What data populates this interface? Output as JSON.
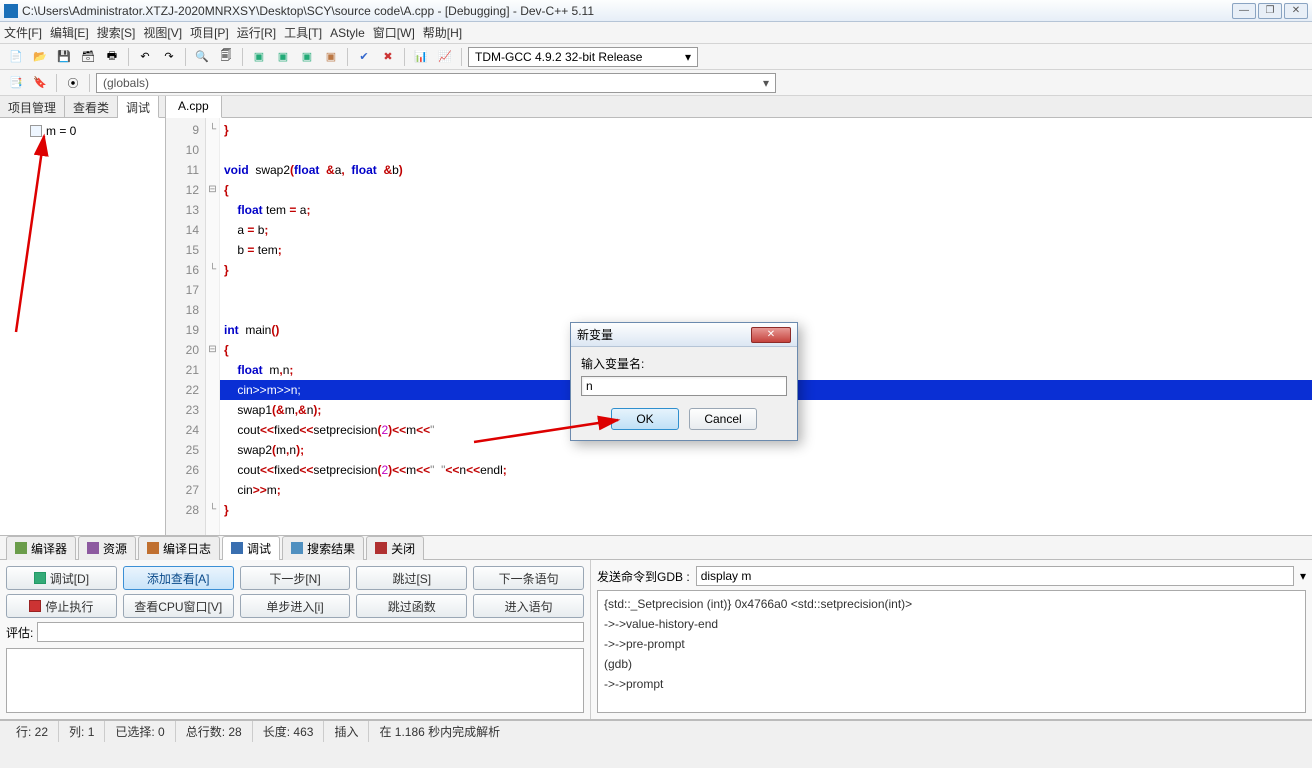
{
  "title": "C:\\Users\\Administrator.XTZJ-2020MNRXSY\\Desktop\\SCY\\source code\\A.cpp - [Debugging] - Dev-C++ 5.11",
  "menu": [
    "文件[F]",
    "编辑[E]",
    "搜索[S]",
    "视图[V]",
    "项目[P]",
    "运行[R]",
    "工具[T]",
    "AStyle",
    "窗口[W]",
    "帮助[H]"
  ],
  "compiler_selector": "TDM-GCC 4.9.2 32-bit Release",
  "globals_dropdown": "(globals)",
  "side_tabs": [
    "项目管理",
    "查看类",
    "调试"
  ],
  "side_active": 2,
  "watch_item": "m = 0",
  "editor_tab": "A.cpp",
  "code_lines": [
    {
      "n": 9,
      "fold": "└",
      "tokens": [
        {
          "c": "br",
          "t": "}"
        }
      ]
    },
    {
      "n": 10,
      "tokens": []
    },
    {
      "n": 11,
      "tokens": [
        {
          "c": "kw",
          "t": "void"
        },
        {
          "t": "  "
        },
        {
          "c": "fn",
          "t": "swap2"
        },
        {
          "c": "br",
          "t": "("
        },
        {
          "c": "typ",
          "t": "float"
        },
        {
          "t": "  "
        },
        {
          "c": "op",
          "t": "&"
        },
        {
          "c": "id",
          "t": "a"
        },
        {
          "c": "op",
          "t": ","
        },
        {
          "t": "  "
        },
        {
          "c": "typ",
          "t": "float"
        },
        {
          "t": "  "
        },
        {
          "c": "op",
          "t": "&"
        },
        {
          "c": "id",
          "t": "b"
        },
        {
          "c": "br",
          "t": ")"
        }
      ]
    },
    {
      "n": 12,
      "fold": "⊟",
      "tokens": [
        {
          "c": "br",
          "t": "{"
        }
      ]
    },
    {
      "n": 13,
      "tokens": [
        {
          "t": "    "
        },
        {
          "c": "typ",
          "t": "float"
        },
        {
          "t": " "
        },
        {
          "c": "id",
          "t": "tem"
        },
        {
          "t": " "
        },
        {
          "c": "op",
          "t": "="
        },
        {
          "t": " "
        },
        {
          "c": "id",
          "t": "a"
        },
        {
          "c": "op",
          "t": ";"
        }
      ]
    },
    {
      "n": 14,
      "tokens": [
        {
          "t": "    "
        },
        {
          "c": "id",
          "t": "a"
        },
        {
          "t": " "
        },
        {
          "c": "op",
          "t": "="
        },
        {
          "t": " "
        },
        {
          "c": "id",
          "t": "b"
        },
        {
          "c": "op",
          "t": ";"
        }
      ]
    },
    {
      "n": 15,
      "tokens": [
        {
          "t": "    "
        },
        {
          "c": "id",
          "t": "b"
        },
        {
          "t": " "
        },
        {
          "c": "op",
          "t": "="
        },
        {
          "t": " "
        },
        {
          "c": "id",
          "t": "tem"
        },
        {
          "c": "op",
          "t": ";"
        }
      ]
    },
    {
      "n": 16,
      "fold": "└",
      "tokens": [
        {
          "c": "br",
          "t": "}"
        }
      ]
    },
    {
      "n": 17,
      "tokens": []
    },
    {
      "n": 18,
      "tokens": []
    },
    {
      "n": 19,
      "tokens": [
        {
          "c": "kw",
          "t": "int"
        },
        {
          "t": "  "
        },
        {
          "c": "fn",
          "t": "main"
        },
        {
          "c": "br",
          "t": "()"
        }
      ]
    },
    {
      "n": 20,
      "fold": "⊟",
      "tokens": [
        {
          "c": "br",
          "t": "{"
        }
      ]
    },
    {
      "n": 21,
      "tokens": [
        {
          "t": "    "
        },
        {
          "c": "typ",
          "t": "float"
        },
        {
          "t": "  "
        },
        {
          "c": "id",
          "t": "m"
        },
        {
          "c": "op",
          "t": ","
        },
        {
          "c": "id",
          "t": "n"
        },
        {
          "c": "op",
          "t": ";"
        }
      ]
    },
    {
      "n": 22,
      "hl": true,
      "raw": "    cin>>m>>n;"
    },
    {
      "n": 23,
      "tokens": [
        {
          "t": "    "
        },
        {
          "c": "fn",
          "t": "swap1"
        },
        {
          "c": "br",
          "t": "("
        },
        {
          "c": "op",
          "t": "&"
        },
        {
          "c": "id",
          "t": "m"
        },
        {
          "c": "op",
          "t": ","
        },
        {
          "c": "op",
          "t": "&"
        },
        {
          "c": "id",
          "t": "n"
        },
        {
          "c": "br",
          "t": ")"
        },
        {
          "c": "op",
          "t": ";"
        }
      ]
    },
    {
      "n": 24,
      "tokens": [
        {
          "t": "    "
        },
        {
          "c": "id",
          "t": "cout"
        },
        {
          "c": "op",
          "t": "<<"
        },
        {
          "c": "id",
          "t": "fixed"
        },
        {
          "c": "op",
          "t": "<<"
        },
        {
          "c": "fn",
          "t": "setprecision"
        },
        {
          "c": "br",
          "t": "("
        },
        {
          "c": "num",
          "t": "2"
        },
        {
          "c": "br",
          "t": ")"
        },
        {
          "c": "op",
          "t": "<<"
        },
        {
          "c": "id",
          "t": "m"
        },
        {
          "c": "op",
          "t": "<<"
        },
        {
          "c": "str",
          "t": "\""
        }
      ]
    },
    {
      "n": 25,
      "tokens": [
        {
          "t": "    "
        },
        {
          "c": "fn",
          "t": "swap2"
        },
        {
          "c": "br",
          "t": "("
        },
        {
          "c": "id",
          "t": "m"
        },
        {
          "c": "op",
          "t": ","
        },
        {
          "c": "id",
          "t": "n"
        },
        {
          "c": "br",
          "t": ")"
        },
        {
          "c": "op",
          "t": ";"
        }
      ]
    },
    {
      "n": 26,
      "tokens": [
        {
          "t": "    "
        },
        {
          "c": "id",
          "t": "cout"
        },
        {
          "c": "op",
          "t": "<<"
        },
        {
          "c": "id",
          "t": "fixed"
        },
        {
          "c": "op",
          "t": "<<"
        },
        {
          "c": "fn",
          "t": "setprecision"
        },
        {
          "c": "br",
          "t": "("
        },
        {
          "c": "num",
          "t": "2"
        },
        {
          "c": "br",
          "t": ")"
        },
        {
          "c": "op",
          "t": "<<"
        },
        {
          "c": "id",
          "t": "m"
        },
        {
          "c": "op",
          "t": "<<"
        },
        {
          "c": "str",
          "t": "\"  \""
        },
        {
          "c": "op",
          "t": "<<"
        },
        {
          "c": "id",
          "t": "n"
        },
        {
          "c": "op",
          "t": "<<"
        },
        {
          "c": "id",
          "t": "endl"
        },
        {
          "c": "op",
          "t": ";"
        }
      ]
    },
    {
      "n": 27,
      "tokens": [
        {
          "t": "    "
        },
        {
          "c": "id",
          "t": "cin"
        },
        {
          "c": "op",
          "t": ">>"
        },
        {
          "c": "id",
          "t": "m"
        },
        {
          "c": "op",
          "t": ";"
        }
      ]
    },
    {
      "n": 28,
      "fold": "└",
      "tokens": [
        {
          "c": "br",
          "t": "}"
        }
      ]
    }
  ],
  "bottom_tabs": [
    {
      "label": "编译器",
      "icon": "#6a9c4a"
    },
    {
      "label": "资源",
      "icon": "#8d5aa0"
    },
    {
      "label": "编译日志",
      "icon": "#c07030"
    },
    {
      "label": "调试",
      "icon": "#3a6fb0",
      "active": true
    },
    {
      "label": "搜索结果",
      "icon": "#5090c0"
    },
    {
      "label": "关闭",
      "icon": "#b03030"
    }
  ],
  "debug_buttons_row1": [
    "调试[D]",
    "添加查看[A]",
    "下一步[N]",
    "跳过[S]",
    "下一条语句"
  ],
  "debug_buttons_row2": [
    "停止执行",
    "查看CPU窗口[V]",
    "单步进入[i]",
    "跳过函数",
    "进入语句"
  ],
  "eval_label": "评估:",
  "gdb_label": "发送命令到GDB :",
  "gdb_value": "display m",
  "gdb_log": [
    "{std::_Setprecision (int)} 0x4766a0 <std::setprecision(int)>",
    "->->value-history-end",
    "->->pre-prompt",
    "(gdb)",
    "->->prompt"
  ],
  "status": {
    "line": "行:  22",
    "col": "列:  1",
    "sel": "已选择:  0",
    "total": "总行数:  28",
    "len": "长度:  463",
    "mode": "插入",
    "parse": "在 1.186 秒内完成解析"
  },
  "dialog": {
    "title": "新变量",
    "prompt": "输入变量名:",
    "value": "n",
    "ok": "OK",
    "cancel": "Cancel"
  }
}
